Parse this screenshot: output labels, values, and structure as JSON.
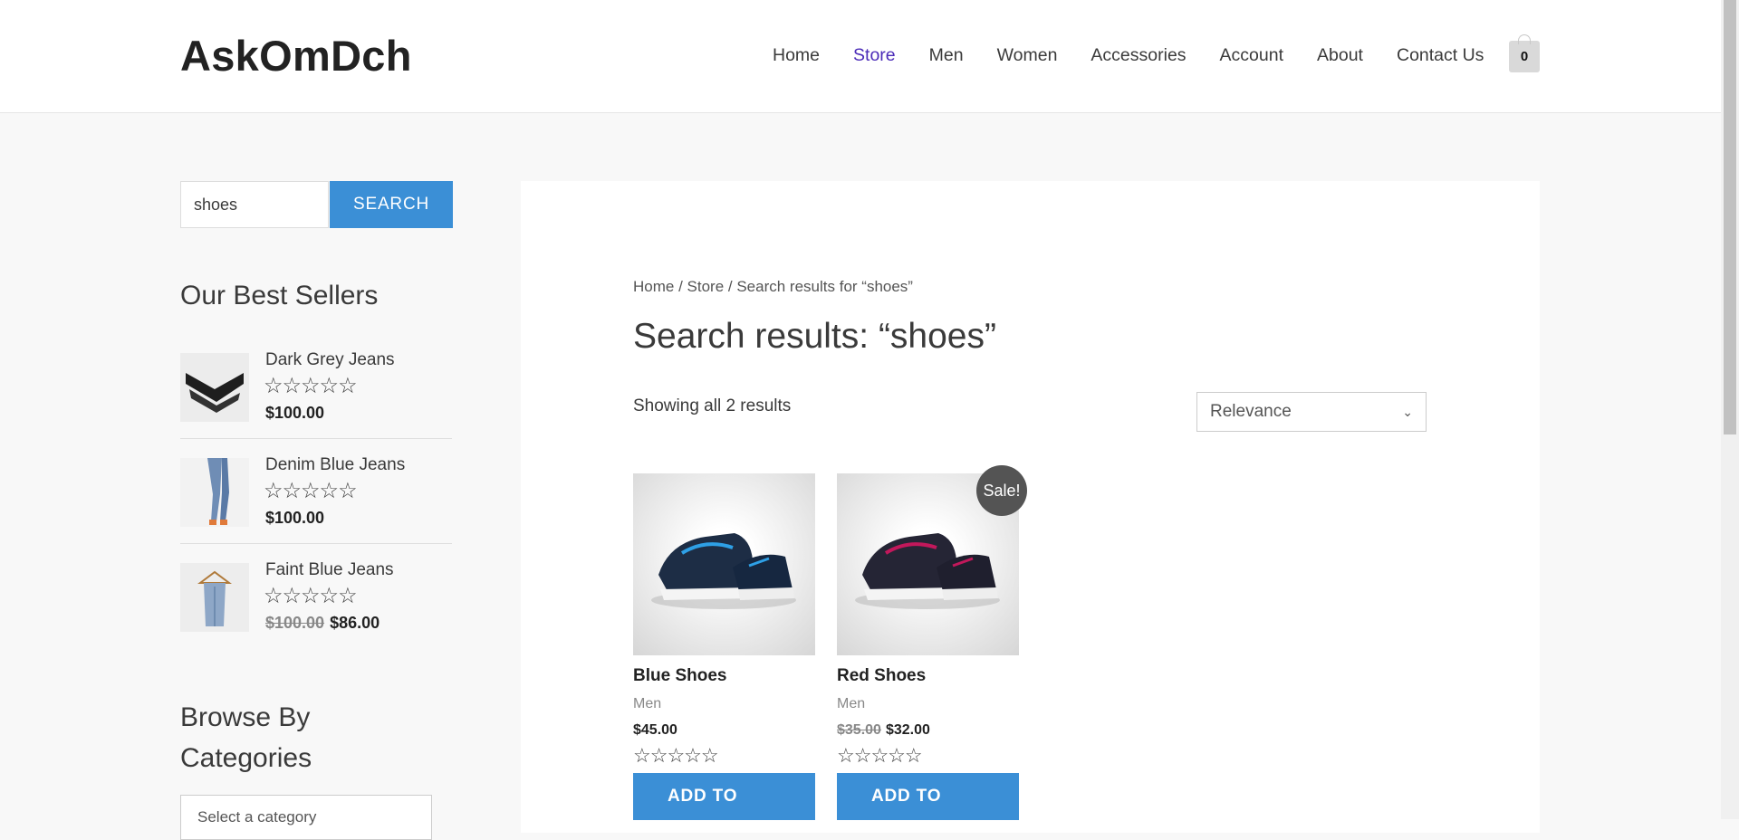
{
  "site": {
    "logo": "AskOmDch"
  },
  "nav": [
    {
      "label": "Home",
      "active": false
    },
    {
      "label": "Store",
      "active": true
    },
    {
      "label": "Men",
      "active": false
    },
    {
      "label": "Women",
      "active": false
    },
    {
      "label": "Accessories",
      "active": false
    },
    {
      "label": "Account",
      "active": false
    },
    {
      "label": "About",
      "active": false
    },
    {
      "label": "Contact Us",
      "active": false
    }
  ],
  "cart": {
    "count": "0"
  },
  "search": {
    "value": "shoes",
    "button": "SEARCH"
  },
  "sidebar": {
    "best_sellers_title": "Our Best Sellers",
    "best_sellers": [
      {
        "name": "Dark Grey Jeans",
        "stars": "☆☆☆☆☆",
        "price": "$100.00",
        "old_price": ""
      },
      {
        "name": "Denim Blue Jeans",
        "stars": "☆☆☆☆☆",
        "price": "$100.00",
        "old_price": ""
      },
      {
        "name": "Faint Blue Jeans",
        "stars": "☆☆☆☆☆",
        "price": "$86.00",
        "old_price": "$100.00"
      }
    ],
    "categories_title": "Browse By Categories",
    "categories_select": "Select a category"
  },
  "main": {
    "breadcrumb": {
      "home": "Home",
      "sep": " / ",
      "store": "Store",
      "current": "Search results for “shoes”"
    },
    "title": "Search results: “shoes”",
    "result_count": "Showing all 2 results",
    "orderby": "Relevance",
    "products": [
      {
        "title": "Blue Shoes",
        "category": "Men",
        "price": "$45.00",
        "old_price": "",
        "stars": "☆☆☆☆☆",
        "button": "ADD TO",
        "sale": false
      },
      {
        "title": "Red Shoes",
        "category": "Men",
        "price": "$32.00",
        "old_price": "$35.00",
        "stars": "☆☆☆☆☆",
        "button": "ADD TO",
        "sale": true,
        "sale_label": "Sale!"
      }
    ]
  },
  "colors": {
    "accent": "#3b8fd6",
    "nav_active": "#4b2bb8",
    "sale_badge": "#545454"
  }
}
